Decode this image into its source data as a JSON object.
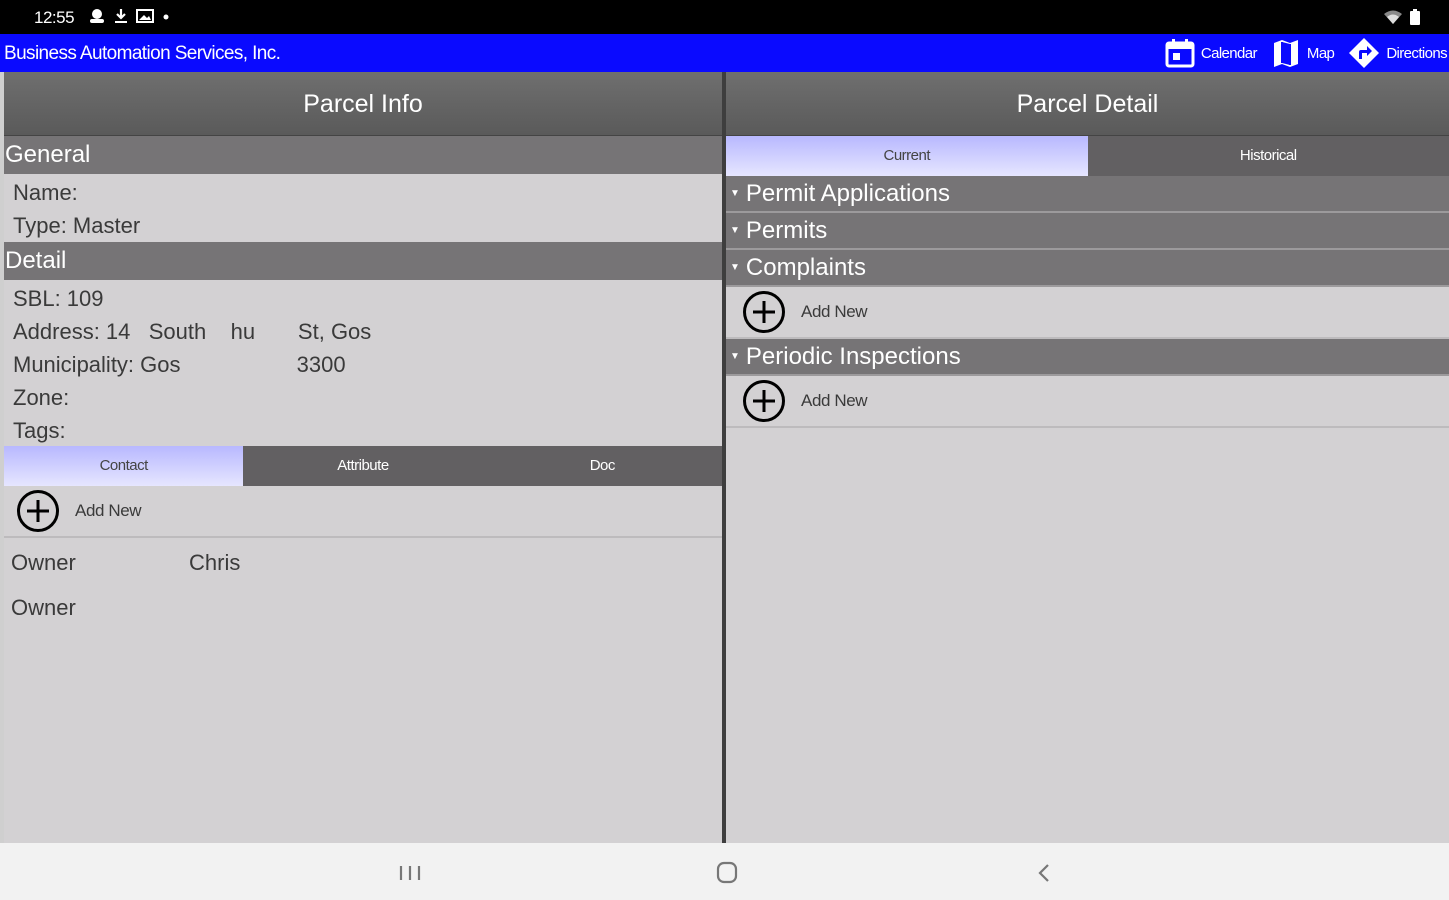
{
  "status_bar": {
    "time": "12:55",
    "icons": [
      "notification-icon",
      "download-icon",
      "image-icon",
      "dot-icon"
    ],
    "right_icons": [
      "wifi-icon",
      "battery-icon"
    ]
  },
  "app_bar": {
    "title": "Business Automation Services, Inc.",
    "color": "#0a0aff",
    "actions": [
      {
        "label": "Calendar",
        "icon": "calendar-icon"
      },
      {
        "label": "Map",
        "icon": "map-icon"
      },
      {
        "label": "Directions",
        "icon": "directions-icon"
      }
    ]
  },
  "parcel_info": {
    "header": "Parcel Info",
    "general": {
      "title": "General",
      "name": "Name:",
      "type": "Type: Master"
    },
    "detail": {
      "title": "Detail",
      "sbl": "SBL: 109",
      "address": "Address: 14   South    hu       St, Gos",
      "municipality": "Municipality: Gos                   3300",
      "zone": "Zone:",
      "tags": "Tags:"
    },
    "tabs": [
      {
        "label": "Contact",
        "active": true
      },
      {
        "label": "Attribute",
        "active": false
      },
      {
        "label": "Doc",
        "active": false
      }
    ],
    "add_new": "Add New",
    "contacts": [
      {
        "role": "Owner",
        "name": "Chris"
      },
      {
        "role": "Owner",
        "name": ""
      }
    ]
  },
  "parcel_detail": {
    "header": "Parcel Detail",
    "tabs": [
      {
        "label": "Current",
        "active": true
      },
      {
        "label": "Historical",
        "active": false
      }
    ],
    "sections": {
      "permit_applications": "Permit Applications",
      "permits": "Permits",
      "complaints": "Complaints",
      "periodic_inspections": "Periodic Inspections"
    },
    "add_new": "Add New"
  },
  "nav_bar": {
    "buttons": [
      "recents-icon",
      "home-icon",
      "back-icon"
    ]
  }
}
